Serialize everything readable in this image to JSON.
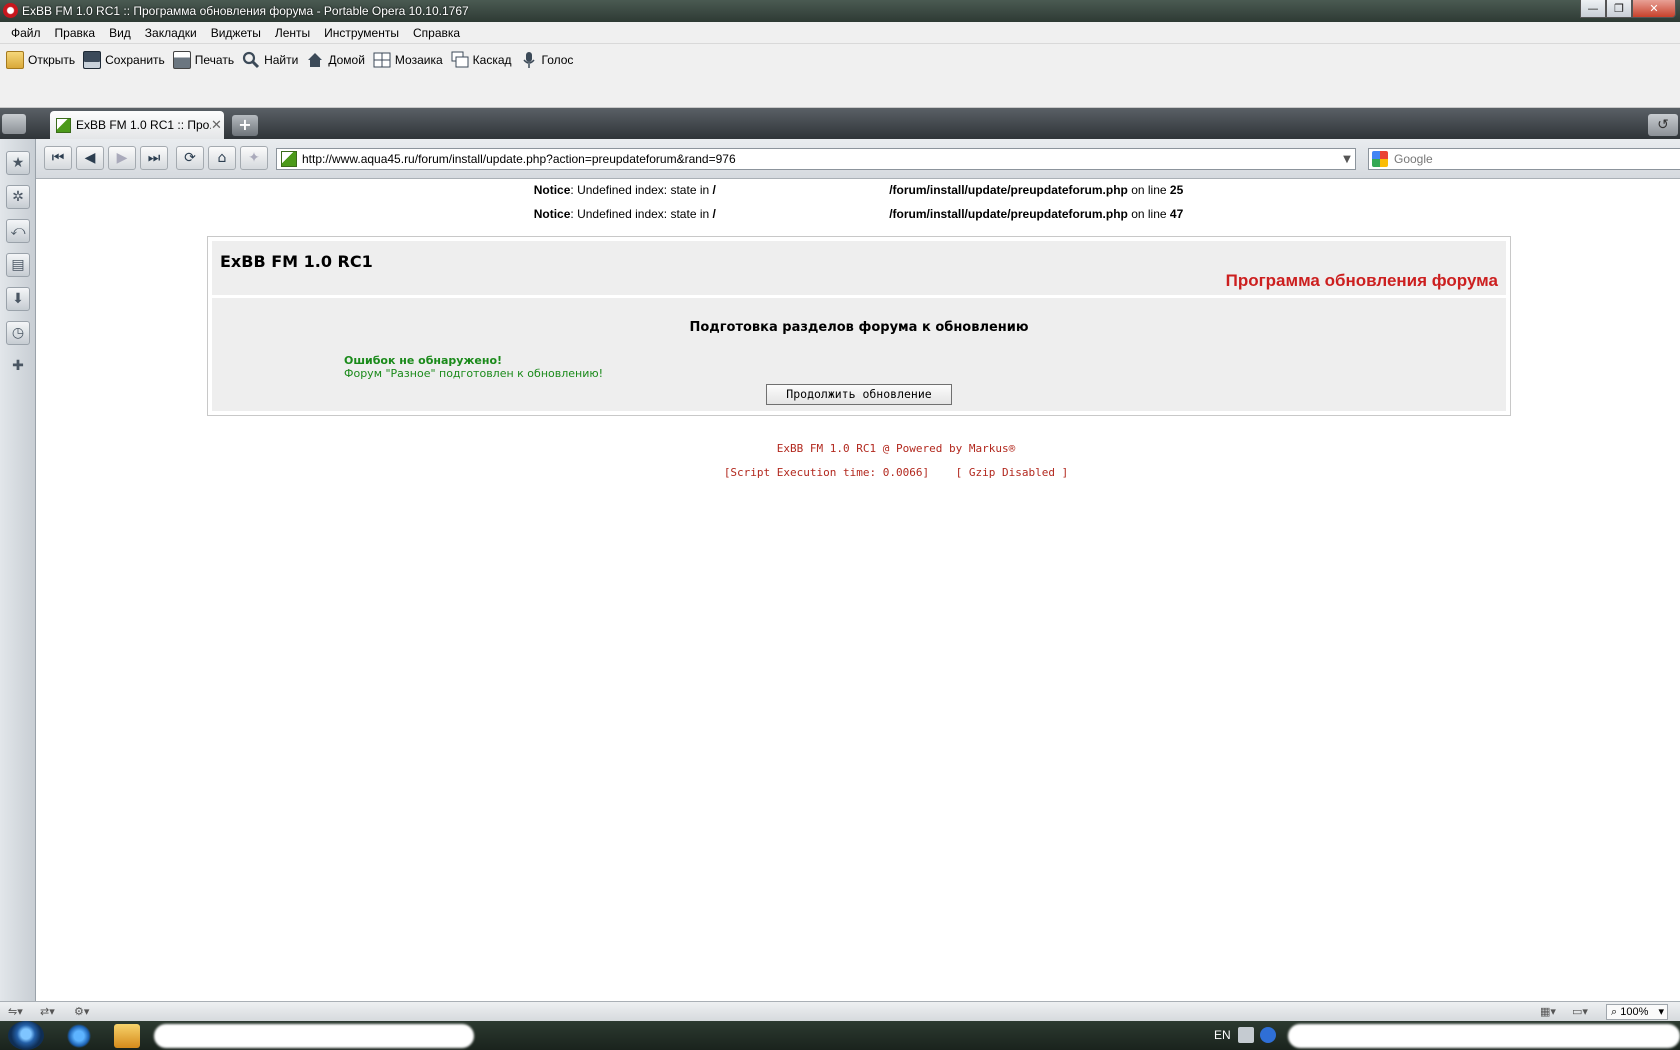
{
  "window": {
    "title": "ExBB FM 1.0 RC1 :: Программа обновления форума - Portable Opera 10.10.1767",
    "buttons": {
      "minimize": "—",
      "restore": "❐",
      "close": "✕"
    }
  },
  "menu": [
    "Файл",
    "Правка",
    "Вид",
    "Закладки",
    "Виджеты",
    "Ленты",
    "Инструменты",
    "Справка"
  ],
  "toolbar": {
    "open": "Открыть",
    "save": "Сохранить",
    "print": "Печать",
    "find": "Найти",
    "home": "Домой",
    "tile": "Мозаика",
    "cascade": "Каскад",
    "voice": "Голос"
  },
  "tabs": [
    {
      "title": "ExBB FM 1.0 RC1 :: Про...",
      "close": "✕"
    }
  ],
  "newtab_label": "+",
  "address": {
    "url": "http://www.aqua45.ru/forum/install/update.php?action=preupdateforum&rand=976",
    "search_placeholder": "Google"
  },
  "page": {
    "notices": [
      {
        "label": "Notice",
        "text": ": Undefined index: state in ",
        "path": "/                                                    /forum/install/update/preupdateforum.php",
        "online": " on line ",
        "line": "25"
      },
      {
        "label": "Notice",
        "text": ": Undefined index: state in ",
        "path": "/                                                    /forum/install/update/preupdateforum.php",
        "online": " on line ",
        "line": "47"
      }
    ],
    "app_title": "ExBB FM 1.0 RC1",
    "subtitle": "Программа обновления форума",
    "section_title": "Подготовка разделов форума к обновлению",
    "ok_message": "Ошибок не обнаружено!",
    "ready_message": "Форум \"Разное\" подготовлен к обновлению!",
    "continue_button": "Продолжить обновление",
    "footer_powered": "ExBB FM 1.0 RC1 @ Powered by Markus®",
    "footer_exec": "[Script Execution time: 0.0066]    [ Gzip Disabled ]"
  },
  "statusbar": {
    "zoom": "100%"
  },
  "taskbar": {
    "lang": "EN"
  },
  "colors": {
    "subtitle_red": "#cc1f1f",
    "ok_green": "#1a8a1a",
    "footer_red": "#b2281e"
  }
}
